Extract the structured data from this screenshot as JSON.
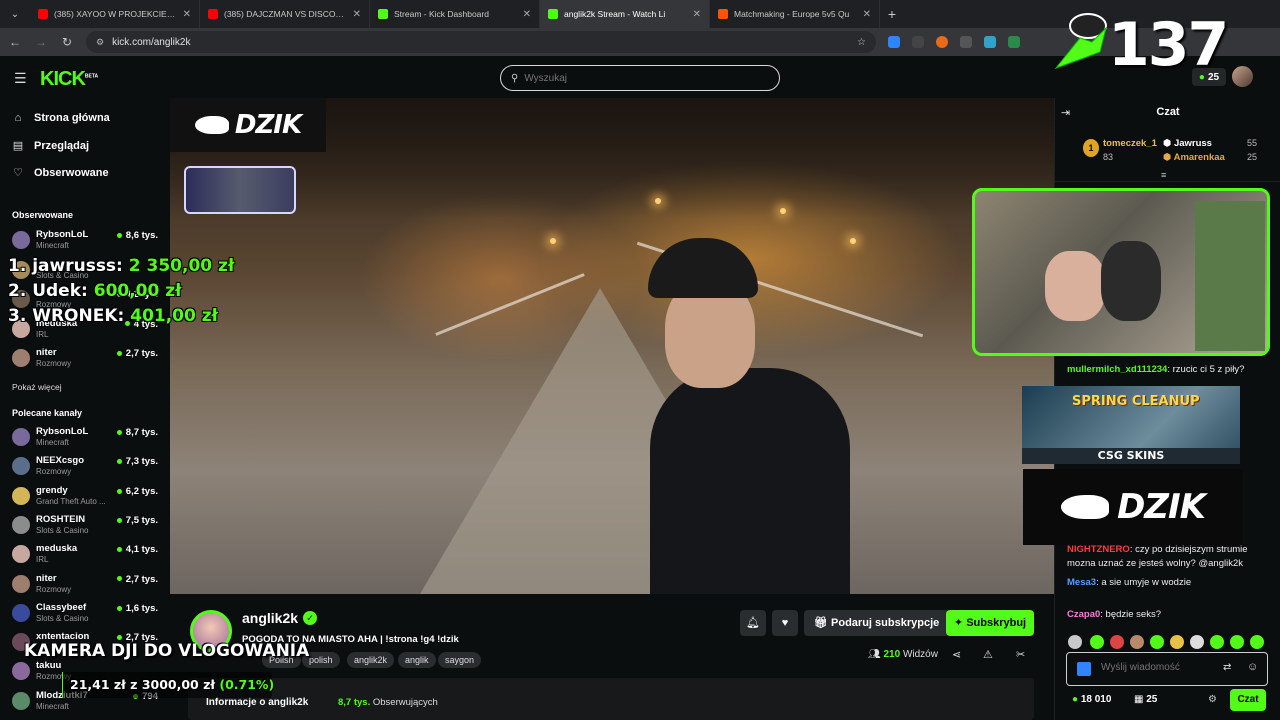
{
  "browser": {
    "tabs": [
      {
        "title": "(385) XAYOO W PROJEKCIE SU",
        "color": "#ff0000",
        "active": false
      },
      {
        "title": "(385) DAJCZMAN VS DISCOKAI",
        "color": "#ff0000",
        "active": false
      },
      {
        "title": "Stream - Kick Dashboard",
        "color": "#53fc18",
        "active": false
      },
      {
        "title": "anglik2k Stream - Watch Li",
        "color": "#53fc18",
        "active": true
      },
      {
        "title": "Matchmaking - Europe 5v5 Qu",
        "color": "#ff5500",
        "active": false
      }
    ],
    "url": "kick.com/anglik2k"
  },
  "kick": {
    "logo": "KICK",
    "logo_badge": "BETA",
    "search_placeholder": "Wyszukaj",
    "points": "25"
  },
  "overlay": {
    "counter": "137",
    "leaderboard": [
      {
        "name": "1. jawrusss:",
        "amount": "2 350,00 zł"
      },
      {
        "name": "2. Udek:",
        "amount": "600,00 zł"
      },
      {
        "name": "3. WRONEK:",
        "amount": "401,00 zł"
      }
    ],
    "dzik": "DZIK",
    "kamera": "KAMERA DJI DO VLOGOWANIA",
    "goal_current": "21,41 zł",
    "goal_sep": "z",
    "goal_target": "3000,00 zł",
    "goal_pct": "(0.71%)",
    "goal_fraction": 0.0071,
    "spring": "SPRING CLEANUP",
    "csgo": "CSG SKINS"
  },
  "sidebar": {
    "nav": [
      {
        "label": "Strona główna",
        "icon": "home-icon"
      },
      {
        "label": "Przeglądaj",
        "icon": "browse-icon"
      },
      {
        "label": "Obserwowane",
        "icon": "heart-icon"
      }
    ],
    "followed_title": "Obserwowane",
    "followed": [
      {
        "name": "RybsonLoL",
        "category": "Minecraft",
        "viewers": "8,6 tys.",
        "color": "#7a6a9c"
      },
      {
        "name": "",
        "category": "Slots & Casino",
        "viewers": "",
        "color": "#a58a5c"
      },
      {
        "name": "",
        "category": "Rozmowy",
        "viewers": "4,2 tys.",
        "color": "#6a5a4a"
      },
      {
        "name": "meduska",
        "category": "IRL",
        "viewers": "4 tys.",
        "color": "#c7a8a0"
      },
      {
        "name": "niter",
        "category": "Rozmowy",
        "viewers": "2,7 tys.",
        "color": "#9e7e6e"
      }
    ],
    "show_more": "Pokaż więcej",
    "recommended_title": "Polecane kanały",
    "recommended": [
      {
        "name": "RybsonLoL",
        "category": "Minecraft",
        "viewers": "8,7 tys.",
        "color": "#7a6a9c"
      },
      {
        "name": "NEEXcsgo",
        "category": "Rozmowy",
        "viewers": "7,3 tys.",
        "color": "#5a6e8c"
      },
      {
        "name": "grendy",
        "category": "Grand Theft Auto ...",
        "viewers": "6,2 tys.",
        "color": "#d4b55a"
      },
      {
        "name": "ROSHTEIN",
        "category": "Slots & Casino",
        "viewers": "7,5 tys.",
        "color": "#8c8c8c"
      },
      {
        "name": "meduska",
        "category": "IRL",
        "viewers": "4,1 tys.",
        "color": "#c7a8a0"
      },
      {
        "name": "niter",
        "category": "Rozmowy",
        "viewers": "2,7 tys.",
        "color": "#9e7e6e"
      },
      {
        "name": "Classybeef",
        "category": "Slots & Casino",
        "viewers": "1,6 tys.",
        "color": "#3a4a9c"
      },
      {
        "name": "xntentacion",
        "category": "",
        "viewers": "2,7 tys.",
        "color": "#6a4a5a"
      },
      {
        "name": "takuu",
        "category": "Rozmowy",
        "viewers": "",
        "color": "#8a6a9c"
      },
      {
        "name": "Mlodziutki7",
        "category": "Minecraft",
        "viewers": "794",
        "color": "#5a8a6a"
      }
    ]
  },
  "stream": {
    "streamer": "anglik2k",
    "title": "POGODA TO NA MIASTO AHA | !strona !g4 !dzik",
    "tags": [
      "Polish",
      "polish",
      "anglik2k",
      "anglik",
      "saygon"
    ],
    "gift_label": "Podaruj subskrypcje",
    "subscribe_label": "Subskrybuj",
    "viewers": "210",
    "viewers_label": "Widzów",
    "about": "Informacje o anglik2k",
    "followers": "8,7 tys.",
    "followers_label": "Obserwujących"
  },
  "chat": {
    "title": "Czat",
    "gifters": [
      {
        "rank": "1",
        "name": "tomeczek_1",
        "value": "83",
        "color": "#e8c14a"
      },
      {
        "name": "Jawruss",
        "value": "55",
        "color": "#ffffff"
      },
      {
        "name": "Amarenkaa",
        "value": "25",
        "color": "#e8a84a"
      }
    ],
    "messages": [
      {
        "user": "mullermilch_xd111234",
        "text": "rzucic ci 5 z piły?",
        "color": "#53fc18"
      },
      {
        "user": "NIGHTZNERO",
        "text": "czy po dzisiejszym strumie mozna uznać ze jesteś wolny? @anglik2k",
        "color": "#ff3b3b"
      },
      {
        "user": "Mesa3",
        "text": "a sie umyje w wodzie",
        "color": "#5a9cff"
      },
      {
        "user": "Czapa0",
        "text": "będzie seks?",
        "color": "#ff7ad9"
      }
    ],
    "input_placeholder": "Wyślij wiadomość",
    "balance": "18 010",
    "subs": "25",
    "send_label": "Czat"
  }
}
